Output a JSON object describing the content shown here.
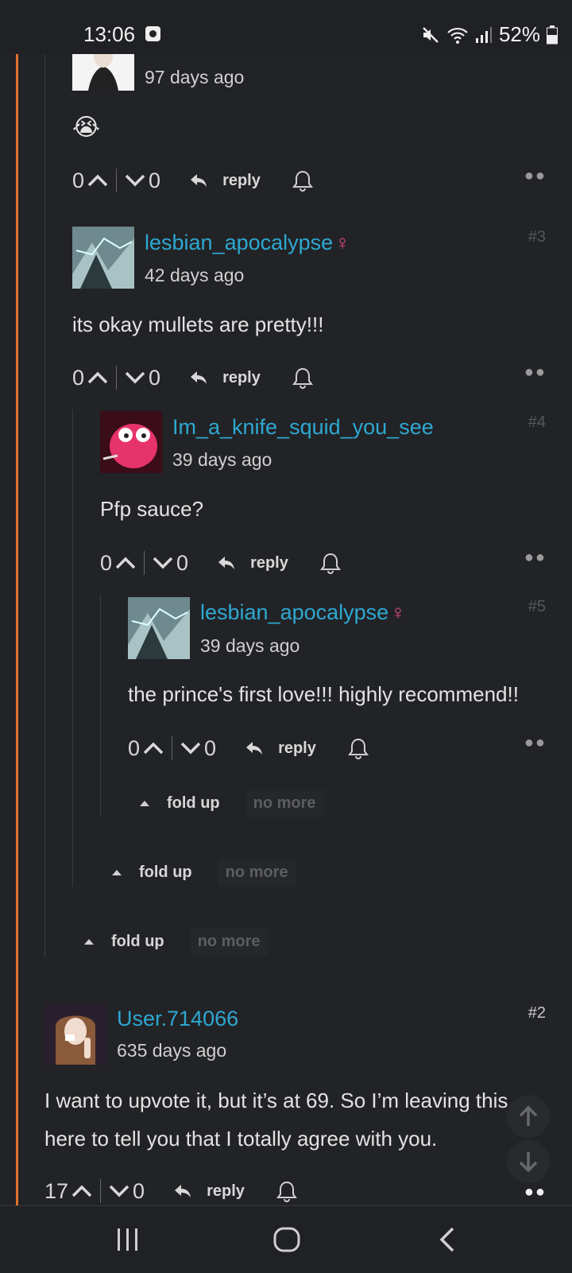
{
  "status_bar": {
    "time": "13:06",
    "battery": "52%"
  },
  "comments": [
    {
      "username": "",
      "time": "97 days ago",
      "content": "😭",
      "up": "0",
      "down": "0",
      "reply_label": "reply",
      "floor": ""
    },
    {
      "username": "lesbian_apocalypse",
      "gender": "♀",
      "time": "42 days ago",
      "content": "its okay mullets are pretty!!!",
      "up": "0",
      "down": "0",
      "reply_label": "reply",
      "floor": "#3"
    },
    {
      "username": "Im_a_knife_squid_you_see",
      "time": "39 days ago",
      "content": "Pfp sauce?",
      "up": "0",
      "down": "0",
      "reply_label": "reply",
      "floor": "#4"
    },
    {
      "username": "lesbian_apocalypse",
      "gender": "♀",
      "time": "39 days ago",
      "content": "the prince's first love!!! highly recommend!!",
      "up": "0",
      "down": "0",
      "reply_label": "reply",
      "floor": "#5"
    },
    {
      "username": "User.714066",
      "time": "635 days ago",
      "content": "I want to upvote it, but it’s at 69. So I’m leaving this here to tell you that I totally agree with you.",
      "up": "17",
      "down": "0",
      "reply_label": "reply",
      "floor": "#2"
    }
  ],
  "fold": {
    "label": "fold up",
    "no_more": "no more"
  }
}
